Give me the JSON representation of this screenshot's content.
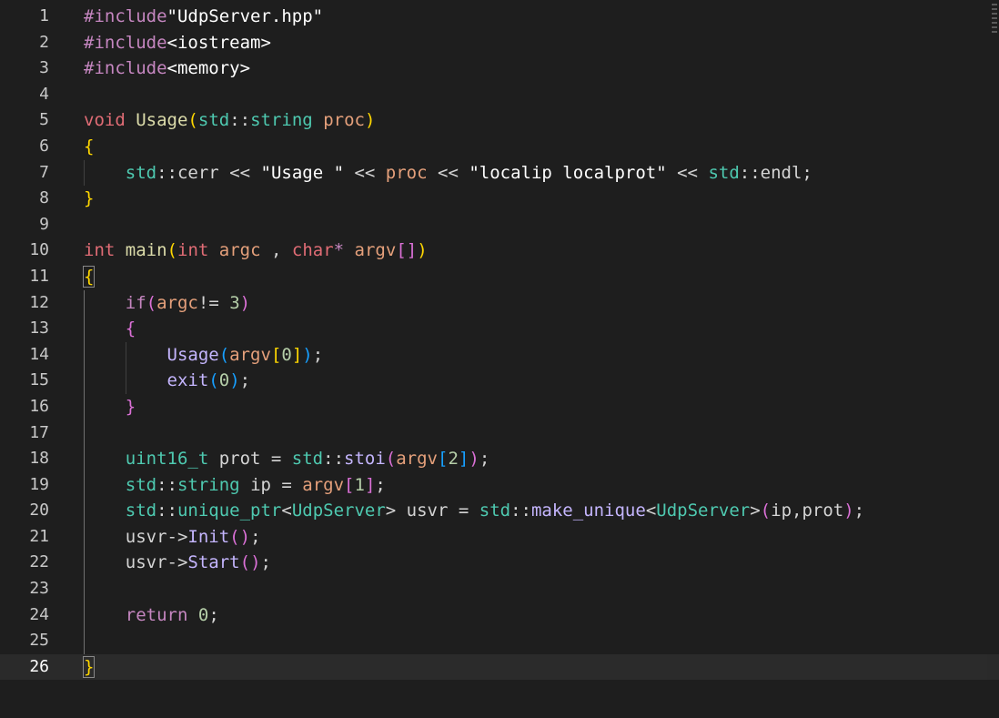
{
  "editor": {
    "line_numbers": [
      "1",
      "2",
      "3",
      "4",
      "5",
      "6",
      "7",
      "8",
      "9",
      "10",
      "11",
      "12",
      "13",
      "14",
      "15",
      "16",
      "17",
      "18",
      "19",
      "20",
      "21",
      "22",
      "23",
      "24",
      "25",
      "26"
    ],
    "current_line": 26,
    "lines": [
      [
        {
          "t": "#include",
          "c": "pp"
        },
        {
          "t": "\"UdpServer.hpp\"",
          "c": "str2"
        }
      ],
      [
        {
          "t": "#include",
          "c": "pp"
        },
        {
          "t": "<iostream>",
          "c": "str2"
        }
      ],
      [
        {
          "t": "#include",
          "c": "pp"
        },
        {
          "t": "<memory>",
          "c": "str2"
        }
      ],
      [],
      [
        {
          "t": "void",
          "c": "void"
        },
        {
          "t": " ",
          "c": "plain"
        },
        {
          "t": "Usage",
          "c": "fn"
        },
        {
          "t": "(",
          "c": "b1"
        },
        {
          "t": "std",
          "c": "ns"
        },
        {
          "t": "::",
          "c": "op"
        },
        {
          "t": "string",
          "c": "cls"
        },
        {
          "t": " ",
          "c": "plain"
        },
        {
          "t": "proc",
          "c": "var"
        },
        {
          "t": ")",
          "c": "b1"
        }
      ],
      [
        {
          "t": "{",
          "c": "b1"
        }
      ],
      [
        {
          "t": "    ",
          "c": "plain"
        },
        {
          "t": "std",
          "c": "ns"
        },
        {
          "t": "::",
          "c": "op"
        },
        {
          "t": "cerr",
          "c": "plain"
        },
        {
          "t": " << ",
          "c": "op"
        },
        {
          "t": "\"Usage \"",
          "c": "str2"
        },
        {
          "t": " << ",
          "c": "op"
        },
        {
          "t": "proc",
          "c": "var"
        },
        {
          "t": " << ",
          "c": "op"
        },
        {
          "t": "\"localip localprot\"",
          "c": "str2"
        },
        {
          "t": " << ",
          "c": "op"
        },
        {
          "t": "std",
          "c": "ns"
        },
        {
          "t": "::",
          "c": "op"
        },
        {
          "t": "endl",
          "c": "plain"
        },
        {
          "t": ";",
          "c": "op"
        }
      ],
      [
        {
          "t": "}",
          "c": "b1"
        }
      ],
      [],
      [
        {
          "t": "int",
          "c": "type"
        },
        {
          "t": " ",
          "c": "plain"
        },
        {
          "t": "main",
          "c": "fn"
        },
        {
          "t": "(",
          "c": "b1"
        },
        {
          "t": "int",
          "c": "type"
        },
        {
          "t": " ",
          "c": "plain"
        },
        {
          "t": "argc",
          "c": "var"
        },
        {
          "t": " , ",
          "c": "op"
        },
        {
          "t": "char",
          "c": "type"
        },
        {
          "t": "*",
          "c": "kw"
        },
        {
          "t": " ",
          "c": "plain"
        },
        {
          "t": "argv",
          "c": "var"
        },
        {
          "t": "[",
          "c": "b2"
        },
        {
          "t": "]",
          "c": "b2"
        },
        {
          "t": ")",
          "c": "b1"
        }
      ],
      [
        {
          "t": "{",
          "c": "b1",
          "box": true
        }
      ],
      [
        {
          "t": "    ",
          "c": "plain"
        },
        {
          "t": "if",
          "c": "kw"
        },
        {
          "t": "(",
          "c": "b2"
        },
        {
          "t": "argc",
          "c": "var"
        },
        {
          "t": "!= ",
          "c": "op"
        },
        {
          "t": "3",
          "c": "num"
        },
        {
          "t": ")",
          "c": "b2"
        }
      ],
      [
        {
          "t": "    ",
          "c": "plain"
        },
        {
          "t": "{",
          "c": "b2"
        }
      ],
      [
        {
          "t": "        ",
          "c": "plain"
        },
        {
          "t": "Usage",
          "c": "fnp"
        },
        {
          "t": "(",
          "c": "b3"
        },
        {
          "t": "argv",
          "c": "var"
        },
        {
          "t": "[",
          "c": "b1"
        },
        {
          "t": "0",
          "c": "num"
        },
        {
          "t": "]",
          "c": "b1"
        },
        {
          "t": ")",
          "c": "b3"
        },
        {
          "t": ";",
          "c": "op"
        }
      ],
      [
        {
          "t": "        ",
          "c": "plain"
        },
        {
          "t": "exit",
          "c": "fnp"
        },
        {
          "t": "(",
          "c": "b3"
        },
        {
          "t": "0",
          "c": "num"
        },
        {
          "t": ")",
          "c": "b3"
        },
        {
          "t": ";",
          "c": "op"
        }
      ],
      [
        {
          "t": "    ",
          "c": "plain"
        },
        {
          "t": "}",
          "c": "b2"
        }
      ],
      [],
      [
        {
          "t": "    ",
          "c": "plain"
        },
        {
          "t": "uint16_t",
          "c": "cls"
        },
        {
          "t": " prot = ",
          "c": "plain"
        },
        {
          "t": "std",
          "c": "ns"
        },
        {
          "t": "::",
          "c": "op"
        },
        {
          "t": "stoi",
          "c": "fnp"
        },
        {
          "t": "(",
          "c": "b2"
        },
        {
          "t": "argv",
          "c": "var"
        },
        {
          "t": "[",
          "c": "b3"
        },
        {
          "t": "2",
          "c": "num"
        },
        {
          "t": "]",
          "c": "b3"
        },
        {
          "t": ")",
          "c": "b2"
        },
        {
          "t": ";",
          "c": "op"
        }
      ],
      [
        {
          "t": "    ",
          "c": "plain"
        },
        {
          "t": "std",
          "c": "ns"
        },
        {
          "t": "::",
          "c": "op"
        },
        {
          "t": "string",
          "c": "cls"
        },
        {
          "t": " ip = ",
          "c": "plain"
        },
        {
          "t": "argv",
          "c": "var"
        },
        {
          "t": "[",
          "c": "b2"
        },
        {
          "t": "1",
          "c": "num"
        },
        {
          "t": "]",
          "c": "b2"
        },
        {
          "t": ";",
          "c": "op"
        }
      ],
      [
        {
          "t": "    ",
          "c": "plain"
        },
        {
          "t": "std",
          "c": "ns"
        },
        {
          "t": "::",
          "c": "op"
        },
        {
          "t": "unique_ptr",
          "c": "cls"
        },
        {
          "t": "<",
          "c": "op"
        },
        {
          "t": "UdpServer",
          "c": "cls"
        },
        {
          "t": ">",
          "c": "op"
        },
        {
          "t": " usvr = ",
          "c": "plain"
        },
        {
          "t": "std",
          "c": "ns"
        },
        {
          "t": "::",
          "c": "op"
        },
        {
          "t": "make_unique",
          "c": "fnp"
        },
        {
          "t": "<",
          "c": "op"
        },
        {
          "t": "UdpServer",
          "c": "cls"
        },
        {
          "t": ">",
          "c": "op"
        },
        {
          "t": "(",
          "c": "b2"
        },
        {
          "t": "ip,prot",
          "c": "plain"
        },
        {
          "t": ")",
          "c": "b2"
        },
        {
          "t": ";",
          "c": "op"
        }
      ],
      [
        {
          "t": "    ",
          "c": "plain"
        },
        {
          "t": "usvr->",
          "c": "plain"
        },
        {
          "t": "Init",
          "c": "fnp"
        },
        {
          "t": "(",
          "c": "b2"
        },
        {
          "t": ")",
          "c": "b2"
        },
        {
          "t": ";",
          "c": "op"
        }
      ],
      [
        {
          "t": "    ",
          "c": "plain"
        },
        {
          "t": "usvr->",
          "c": "plain"
        },
        {
          "t": "Start",
          "c": "fnp"
        },
        {
          "t": "(",
          "c": "b2"
        },
        {
          "t": ")",
          "c": "b2"
        },
        {
          "t": ";",
          "c": "op"
        }
      ],
      [],
      [
        {
          "t": "    ",
          "c": "plain"
        },
        {
          "t": "return",
          "c": "kw"
        },
        {
          "t": " ",
          "c": "plain"
        },
        {
          "t": "0",
          "c": "num"
        },
        {
          "t": ";",
          "c": "op"
        }
      ],
      [],
      [
        {
          "t": "}",
          "c": "b1",
          "box": true
        }
      ]
    ]
  },
  "colors": {
    "background": "#1e1e1e",
    "current_line": "#2b2b2b",
    "bracket_level1": "#ffd700",
    "bracket_level2": "#da70d6",
    "bracket_level3": "#179fff"
  }
}
